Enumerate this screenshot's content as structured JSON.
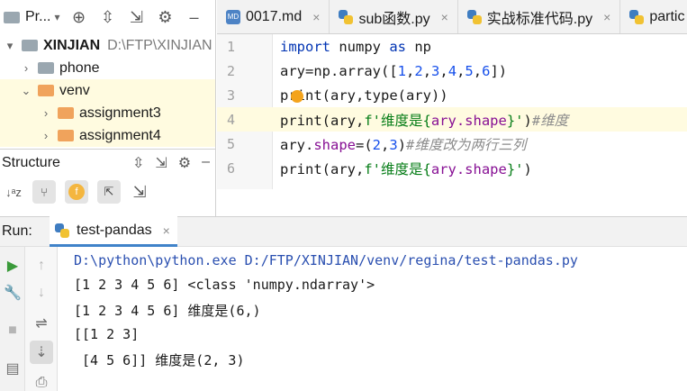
{
  "project": {
    "title": "Pr...",
    "items": [
      {
        "label": "XINJIAN",
        "path": "D:\\FTP\\XINJIAN",
        "chevron": "▾",
        "expanded": true
      },
      {
        "label": "phone",
        "chevron": "›"
      },
      {
        "label": "venv",
        "chevron": "⌄",
        "expanded": true
      },
      {
        "label": "assignment3",
        "chevron": "›"
      },
      {
        "label": "assignment4",
        "chevron": "›"
      }
    ]
  },
  "structure": {
    "title": "Structure",
    "f_badge": "f"
  },
  "editor": {
    "tabs": [
      {
        "label": "0017.md",
        "type": "md",
        "md_badge": "MD"
      },
      {
        "label": "sub函数.py",
        "type": "py"
      },
      {
        "label": "实战标准代码.py",
        "type": "py"
      },
      {
        "label": "partic",
        "type": "py"
      }
    ],
    "line_numbers": [
      "1",
      "2",
      "3",
      "4",
      "5",
      "6"
    ],
    "lines": [
      {
        "kw1": "import",
        "t1": " numpy ",
        "kw2": "as",
        "t2": " np"
      },
      {
        "t1": "ary=np.array([",
        "n1": "1",
        "c1": ",",
        "n2": "2",
        "c2": ",",
        "n3": "3",
        "c3": ",",
        "n4": "4",
        "c4": ",",
        "n5": "5",
        "c5": ",",
        "n6": "6",
        "t2": "])"
      },
      {
        "t1": "print(ary,type(ary))"
      },
      {
        "t1": "print(ary,",
        "s1": "f'维度是{",
        "fld": "ary.shape",
        "s2": "}'",
        "t2": ")",
        "cmt": "#维度"
      },
      {
        "t1": "ary.",
        "fld": "shape",
        "t2": "=(",
        "n1": "2",
        "c1": ",",
        "n2": "3",
        "t3": ")",
        "cmt": "#维度改为两行三列"
      },
      {
        "t1": "print(ary,",
        "s1": "f'维度是{",
        "fld": "ary.shape",
        "s2": "}'",
        "t2": ")"
      }
    ]
  },
  "run": {
    "label": "Run:",
    "tab_label": "test-pandas",
    "output": [
      "D:\\python\\python.exe D:/FTP/XINJIAN/venv/regina/test-pandas.py",
      "[1 2 3 4 5 6] <class 'numpy.ndarray'>",
      "[1 2 3 4 5 6] 维度是(6,)",
      "[[1 2 3]",
      " [4 5 6]] 维度是(2, 3)"
    ]
  }
}
